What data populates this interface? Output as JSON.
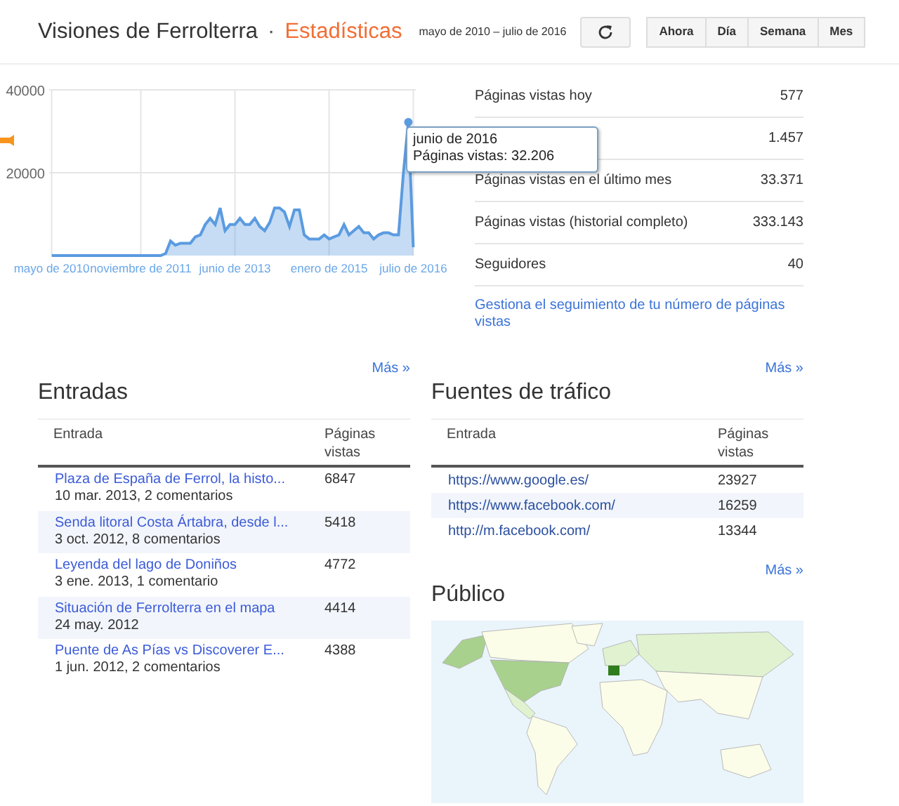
{
  "header": {
    "title": "Visiones de Ferrolterra",
    "separator": "·",
    "section": "Estadísticas",
    "date_range": "mayo de 2010 – julio de 2016",
    "tabs": [
      {
        "label": "Ahora",
        "selected": false
      },
      {
        "label": "Día",
        "selected": false
      },
      {
        "label": "Semana",
        "selected": false
      },
      {
        "label": "Mes",
        "selected": false
      }
    ]
  },
  "chart": {
    "chart_data": {
      "type": "area",
      "grid": true,
      "ylim": [
        0,
        40000
      ],
      "yticks": [
        20000,
        40000
      ],
      "categories": [
        "mayo de 2010",
        null,
        null,
        null,
        null,
        null,
        null,
        null,
        null,
        null,
        null,
        null,
        null,
        null,
        null,
        null,
        null,
        null,
        "noviembre de 2011",
        null,
        null,
        null,
        null,
        null,
        null,
        null,
        null,
        null,
        null,
        null,
        null,
        null,
        null,
        null,
        null,
        null,
        null,
        "junio de 2013",
        null,
        null,
        null,
        null,
        null,
        null,
        null,
        null,
        null,
        null,
        null,
        null,
        null,
        null,
        null,
        null,
        null,
        null,
        "enero de 2015",
        null,
        null,
        null,
        null,
        null,
        null,
        null,
        null,
        null,
        null,
        null,
        null,
        null,
        null,
        null,
        null,
        "julio de 2016"
      ],
      "series": [
        {
          "color": "#5b9be0",
          "values": [
            0,
            0,
            0,
            0,
            0,
            0,
            0,
            0,
            0,
            0,
            0,
            0,
            0,
            0,
            0,
            0,
            0,
            0,
            0,
            0,
            0,
            0,
            0,
            500,
            3500,
            2500,
            3000,
            3000,
            3000,
            4500,
            5000,
            7500,
            9000,
            7500,
            11500,
            6000,
            7500,
            7500,
            9000,
            7500,
            7500,
            9000,
            7000,
            6000,
            8000,
            11500,
            11500,
            10500,
            7000,
            11000,
            11000,
            5000,
            4000,
            4000,
            4000,
            5000,
            4000,
            4500,
            5000,
            7500,
            5000,
            6000,
            7000,
            5500,
            5500,
            4000,
            5000,
            5500,
            5500,
            5000,
            5000,
            20000,
            32206,
            2000
          ]
        }
      ]
    },
    "tooltip": {
      "date": "junio de 2016",
      "value": "Páginas vistas: 32.206"
    }
  },
  "stats": [
    {
      "label": "Páginas vistas hoy",
      "value": "577"
    },
    {
      "value": "1.457"
    },
    {
      "label": "Páginas vistas en el último mes",
      "value": "33.371"
    },
    {
      "label": "Páginas vistas (historial completo)",
      "value": "333.143"
    },
    {
      "label": "Seguidores",
      "value": "40"
    }
  ],
  "stats_link": "Gestiona el seguimiento de tu número de páginas vistas",
  "entradas": {
    "title": "Entradas",
    "more": "Más »",
    "columns": [
      "Entrada",
      "Páginas vistas"
    ],
    "rows": [
      {
        "title": "Plaza de España de Ferrol, la histo...",
        "meta": "10 mar. 2013, 2 comentarios",
        "views": "6847"
      },
      {
        "title": "Senda litoral Costa Ártabra, desde l...",
        "meta": "3 oct. 2012, 8 comentarios",
        "views": "5418"
      },
      {
        "title": "Leyenda del lago de Doniños",
        "meta": "3 ene. 2013, 1 comentario",
        "views": "4772"
      },
      {
        "title": "Situación de Ferrolterra en el mapa",
        "meta": "24 may. 2012",
        "views": "4414"
      },
      {
        "title": "Puente de As Pías vs Discoverer E...",
        "meta": "1 jun. 2012, 2 comentarios",
        "views": "4388"
      }
    ]
  },
  "fuentes": {
    "title": "Fuentes de tráfico",
    "more": "Más »",
    "columns": [
      "Entrada",
      "Páginas vistas"
    ],
    "rows": [
      {
        "url": "https://www.google.es/",
        "views": "23927"
      },
      {
        "url": "https://www.facebook.com/",
        "views": "16259"
      },
      {
        "url": "http://m.facebook.com/",
        "views": "13344"
      }
    ]
  },
  "publico": {
    "title": "Público",
    "more": "Más »"
  }
}
